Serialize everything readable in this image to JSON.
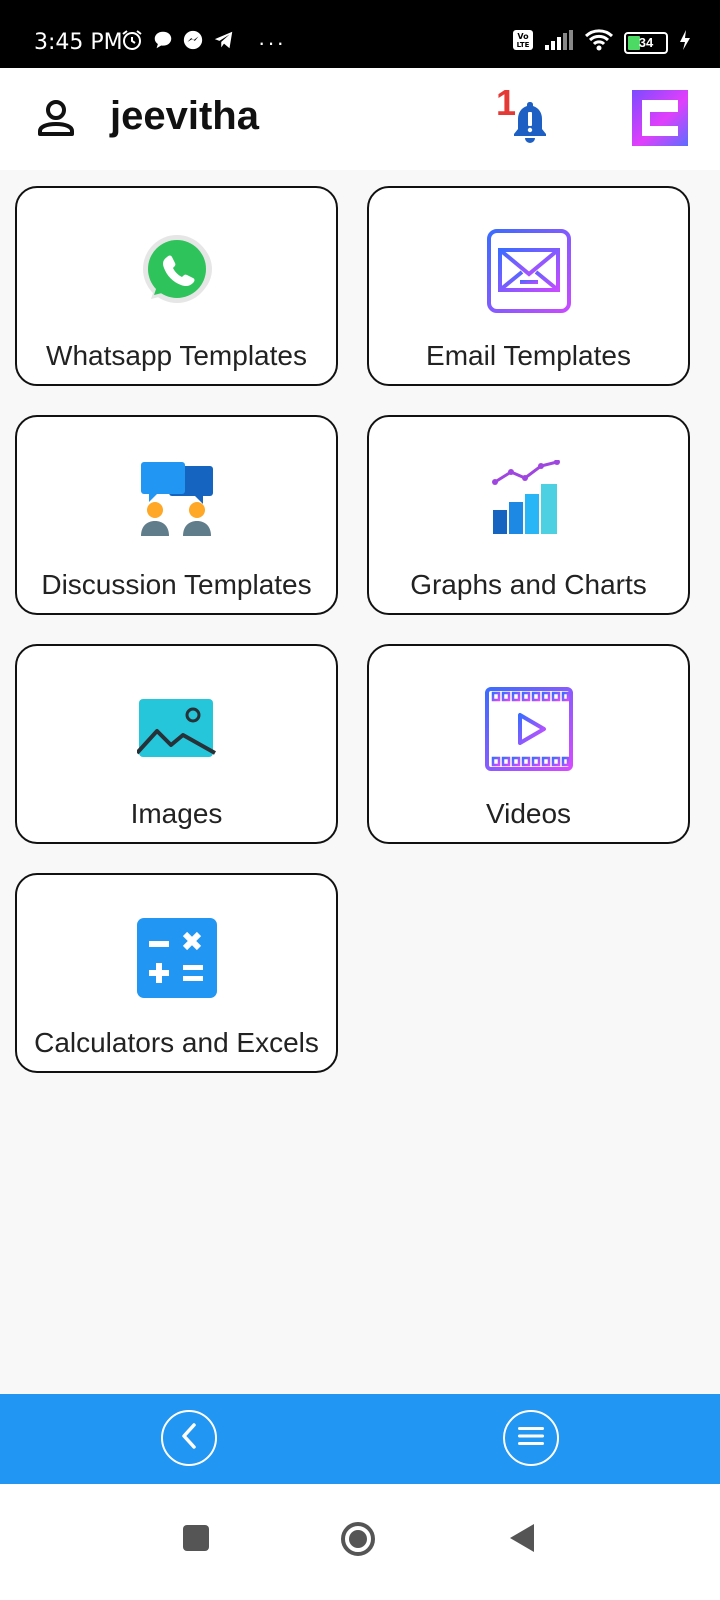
{
  "status_bar": {
    "time": "3:45 PM",
    "more": "···",
    "battery": "34",
    "icons": [
      "alarm-icon",
      "chat-bubble-icon",
      "messenger-icon",
      "telegram-icon",
      "volte-icon",
      "signal-icon",
      "wifi-icon",
      "battery-icon",
      "charging-icon"
    ]
  },
  "header": {
    "username": "jeevitha",
    "notification_count": "1",
    "icons": [
      "user-icon",
      "bell-icon",
      "brand-logo"
    ]
  },
  "cards": [
    {
      "label": "Whatsapp Templates",
      "icon": "whatsapp-icon"
    },
    {
      "label": "Email Templates",
      "icon": "email-icon"
    },
    {
      "label": "Discussion Templates",
      "icon": "discussion-icon"
    },
    {
      "label": "Graphs and Charts",
      "icon": "chart-icon"
    },
    {
      "label": "Images",
      "icon": "image-icon"
    },
    {
      "label": "Videos",
      "icon": "video-icon"
    },
    {
      "label": "Calculators and Excels",
      "icon": "calculator-icon"
    }
  ],
  "bottom_bar": {
    "icons": [
      "back-circle-icon",
      "menu-circle-icon"
    ],
    "color": "#2196f3"
  },
  "system_nav": {
    "icons": [
      "recents-icon",
      "home-icon",
      "back-icon"
    ]
  }
}
